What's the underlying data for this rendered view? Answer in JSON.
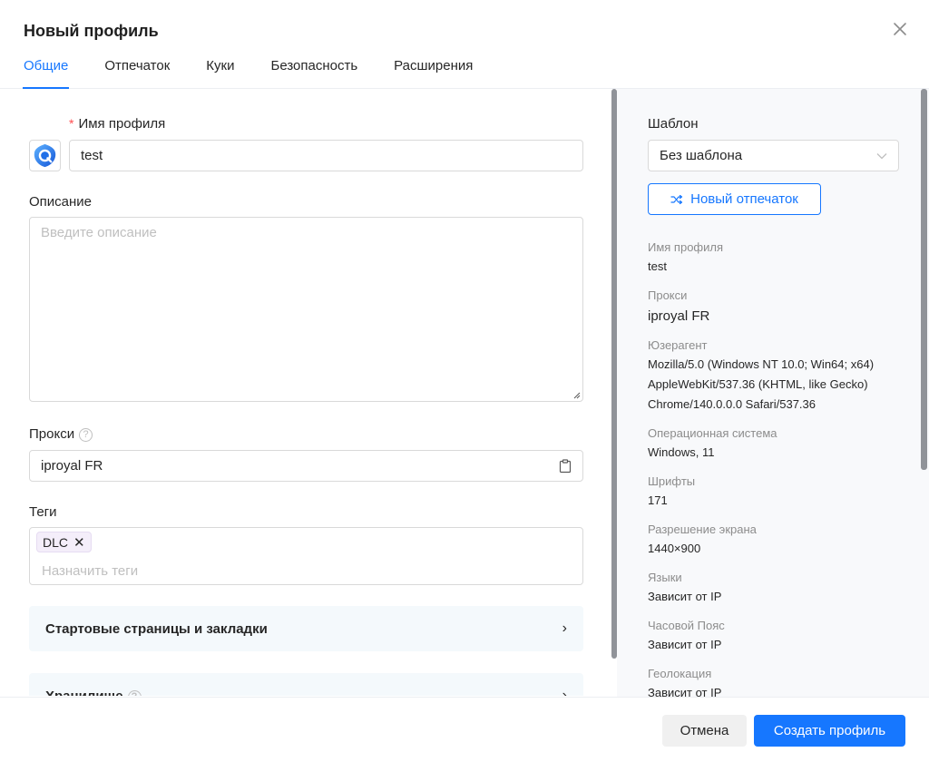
{
  "dialog": {
    "title": "Новый профиль",
    "close_icon": "close-icon"
  },
  "tabs": [
    {
      "label": "Общие",
      "active": true
    },
    {
      "label": "Отпечаток",
      "active": false
    },
    {
      "label": "Куки",
      "active": false
    },
    {
      "label": "Безопасность",
      "active": false
    },
    {
      "label": "Расширения",
      "active": false
    }
  ],
  "form": {
    "profile_name": {
      "required_mark": "*",
      "label": "Имя профиля",
      "value": "test",
      "icon": "browser-logo-icon"
    },
    "description": {
      "label": "Описание",
      "placeholder": "Введите описание",
      "value": ""
    },
    "proxy": {
      "label": "Прокси",
      "help_icon": "?",
      "value": "iproyal FR",
      "icon": "clipboard-icon"
    },
    "tags": {
      "label": "Теги",
      "items": [
        {
          "label": "DLC",
          "remove": "✕"
        }
      ],
      "placeholder": "Назначить теги"
    },
    "sections": [
      {
        "label": "Стартовые страницы и закладки",
        "chevron": "›"
      },
      {
        "label": "Хранилище",
        "chevron": "›",
        "help_icon": "?"
      }
    ]
  },
  "summary": {
    "template": {
      "label": "Шаблон",
      "value": "Без шаблона"
    },
    "new_fingerprint_label": "Новый отпечаток",
    "fields": [
      {
        "label": "Имя профиля",
        "value": "test"
      },
      {
        "label": "Прокси",
        "value": "iproyal FR"
      },
      {
        "label": "Юзерагент",
        "value": "Mozilla/5.0 (Windows NT 10.0; Win64; x64) AppleWebKit/537.36 (KHTML, like Gecko) Chrome/140.0.0.0 Safari/537.36"
      },
      {
        "label": "Операционная система",
        "value": "Windows, 11"
      },
      {
        "label": "Шрифты",
        "value": "171"
      },
      {
        "label": "Разрешение экрана",
        "value": "1440×900"
      },
      {
        "label": "Языки",
        "value": "Зависит от IP"
      },
      {
        "label": "Часовой Пояс",
        "value": "Зависит от IP"
      },
      {
        "label": "Геолокация",
        "value": "Зависит от IP"
      }
    ]
  },
  "footer": {
    "cancel_label": "Отмена",
    "create_label": "Создать профиль"
  },
  "colors": {
    "accent": "#1677ff",
    "required": "#ff4d4f",
    "tag_bg": "#f4eefa",
    "section_bg": "#f4f9fc",
    "summary_bg": "#f8f9fb"
  }
}
